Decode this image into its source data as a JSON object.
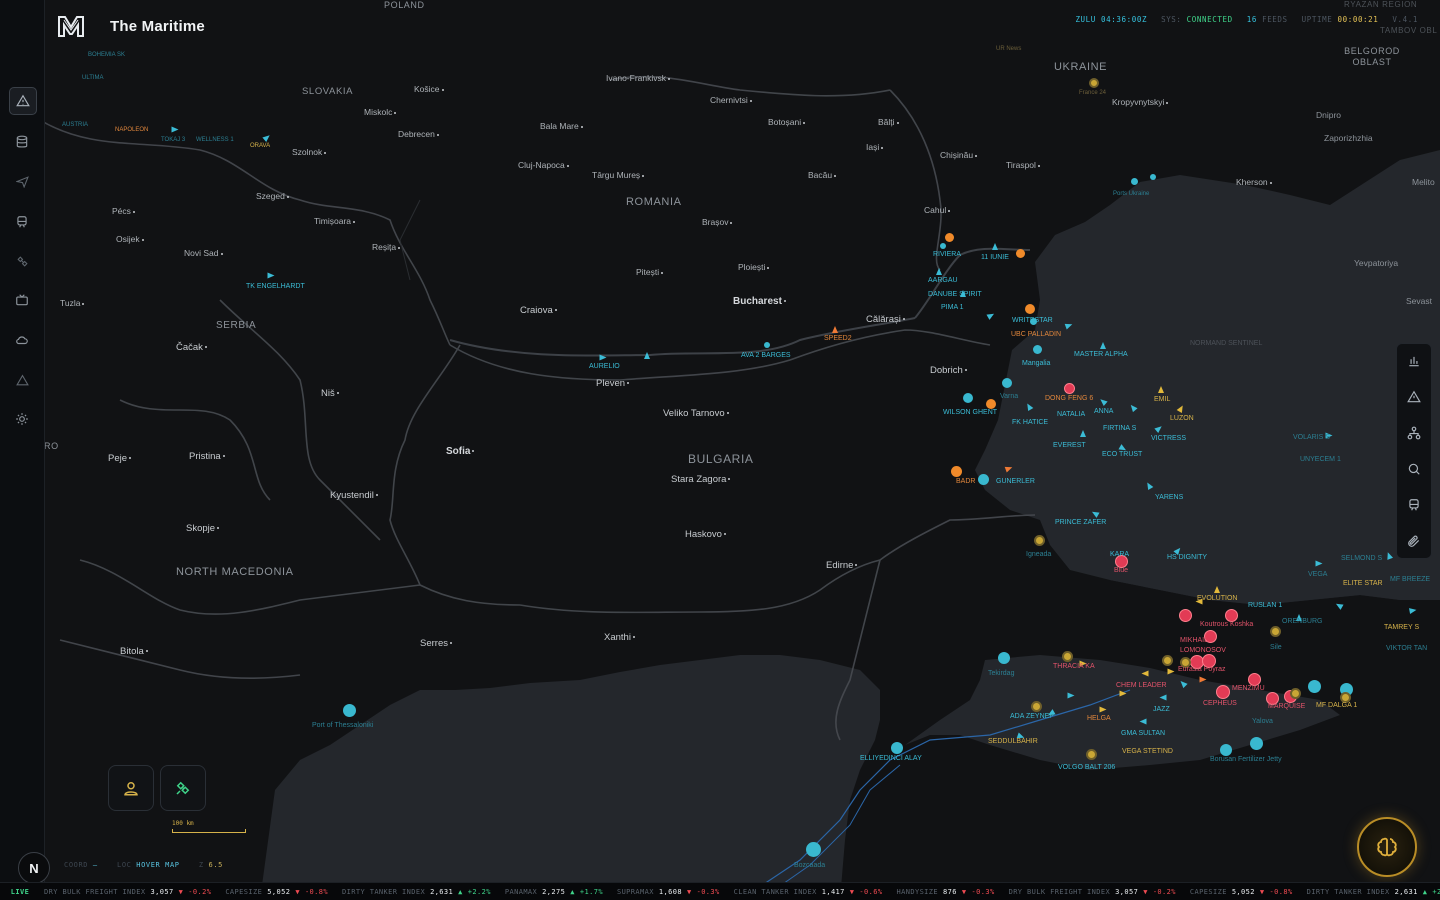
{
  "app": {
    "title": "The Maritime"
  },
  "status": {
    "zulu_label": "ZULU",
    "zulu_time": "04:36:00Z",
    "sys_label": "SYS:",
    "sys_value": "CONNECTED",
    "feeds_count": "16",
    "feeds_label": "FEEDS",
    "uptime_label": "UPTIME",
    "uptime_value": "00:00:21",
    "version": "V.4.1"
  },
  "left_rail": {
    "items": [
      "alert-triangle-icon",
      "database-icon",
      "aircraft-icon",
      "train-icon",
      "satellite-icon",
      "tv-icon",
      "cloud-icon",
      "warning-icon",
      "sun-icon"
    ]
  },
  "right_tools": {
    "items": [
      "bar-chart-icon",
      "alert-icon",
      "network-icon",
      "search-icon",
      "train-icon",
      "paperclip-icon"
    ]
  },
  "countries": [
    "POLAND",
    "UKRAINE",
    "SLOVAKIA",
    "ROMANIA",
    "SERBIA",
    "BULGARIA",
    "NORTH MACEDONIA",
    "BELGOROD OBLAST",
    "RYAZAN REGION",
    "TAMBOV OBL",
    "RO"
  ],
  "cities": [
    "Ivano-Frankivsk",
    "Chernivtsi",
    "Košice",
    "Miskolc",
    "Bala Mare",
    "Debrecen",
    "Botoșani",
    "Bălți",
    "Iași",
    "Chișinău",
    "Tiraspol",
    "Kropyvnytskyi",
    "Dnipro",
    "Zaporizhzhia",
    "Kherson",
    "Melito",
    "Szolnok",
    "Cluj-Napoca",
    "Târgu Mureș",
    "Bacău",
    "Szeged",
    "Pécs",
    "Osijek",
    "Timișoara",
    "Reșița",
    "Cahul",
    "Novi Sad",
    "Yevpatoriya",
    "Pitești",
    "Ploiești",
    "Brașov",
    "Bucharest",
    "Tuzla",
    "Craiova",
    "Călărași",
    "Sevast",
    "Čačak",
    "Pleven",
    "Dobrich",
    "Niš",
    "Veliko Tarnovo",
    "Sofia",
    "Pristina",
    "Peje",
    "Stara Zagora",
    "Kyustendil",
    "Skopje",
    "Haskovo",
    "Edirne",
    "Xanthi",
    "Serres",
    "Bitola"
  ],
  "vessels": [
    "RIVIERA",
    "11 IUNIE",
    "AARGAU",
    "DANUBE SPIRIT",
    "PIMA 1",
    "WRITESTAR",
    "UBC PALLADIN",
    "MASTER ALPHA",
    "NORMAND SENTINEL",
    "Mangalia",
    "DONG FENG 6",
    "EMIL",
    "LUZON",
    "NATALIA",
    "ANNA",
    "WILSON GHENT",
    "Varna",
    "FK HATICE",
    "FIRTINA S",
    "VICTRESS",
    "VOLARIS S",
    "EVEREST",
    "ECO TRUST",
    "UNYECEM 1",
    "BADR",
    "GUNERLER",
    "YARENS",
    "PRINCE ZAFER",
    "Igneada",
    "KARA",
    "Blue",
    "HS DIGNITY",
    "SELMOND S",
    "VEGA",
    "ELITE STAR",
    "MF BREEZE",
    "EVOLUTION",
    "RUSLAN 1",
    "ORENBURG",
    "TAMREY S",
    "Koutrous Koshka",
    "VIKTOR TAN",
    "MIKHAIL LOMONOSOV",
    "Sile",
    "THRACIA KA",
    "Eurasia Poyraz",
    "Tekirdag",
    "CHEM LEADER",
    "MENZIMU",
    "JAZZ",
    "CEPHEUS",
    "MARQUISE",
    "MF DALGA 1",
    "ADA ZEYNEP",
    "HELGA",
    "Yalova",
    "GMA SULTAN",
    "SEDDULBAHIR",
    "VEGA STETIND",
    "ELLIYEDINCI ALAY",
    "Borusan Fertilizer Jetty",
    "VOLGO BALT 206",
    "Port of Thessaloniki",
    "Bozcaada",
    "SPEED2",
    "AURELIO",
    "AVA 2 BARGES",
    "TK ENGELHARDT",
    "TOKAJ 3",
    "WELLNESS 1",
    "ORAVA",
    "NAPOLEON",
    "AUSTRIA",
    "BOHEMIA SK",
    "ULTIMA",
    "UR News",
    "France 24",
    "Ports Ukraine"
  ],
  "scale": {
    "label": "100 km"
  },
  "coord_bar": {
    "coord_label": "COORD",
    "coord_value": "—",
    "loc_label": "LOC",
    "loc_value": "HOVER MAP",
    "z_label": "Z",
    "z_value": "6.5"
  },
  "n_button": "N",
  "live_label": "LIVE",
  "ticker": [
    {
      "name": "DRY BULK FREIGHT INDEX",
      "value": "3,057",
      "dir": "down",
      "change": "-0.2%"
    },
    {
      "name": "CAPESIZE",
      "value": "5,052",
      "dir": "down",
      "change": "-0.8%"
    },
    {
      "name": "DIRTY TANKER INDEX",
      "value": "2,631",
      "dir": "up",
      "change": "+2.2%"
    },
    {
      "name": "PANAMAX",
      "value": "2,275",
      "dir": "up",
      "change": "+1.7%"
    },
    {
      "name": "SUPRAMAX",
      "value": "1,608",
      "dir": "down",
      "change": "-0.3%"
    },
    {
      "name": "CLEAN TANKER INDEX",
      "value": "1,417",
      "dir": "down",
      "change": "-0.6%"
    },
    {
      "name": "HANDYSIZE",
      "value": "876",
      "dir": "down",
      "change": "-0.3%"
    },
    {
      "name": "DRY BULK FREIGHT INDEX",
      "value": "3,057",
      "dir": "down",
      "change": "-0.2%"
    },
    {
      "name": "CAPESIZE",
      "value": "5,052",
      "dir": "down",
      "change": "-0.8%"
    },
    {
      "name": "DIRTY TANKER INDEX",
      "value": "2,631",
      "dir": "up",
      "change": "+2.2%"
    }
  ],
  "colors": {
    "accent_cyan": "#36c3e0",
    "accent_gold": "#c9a635",
    "alert_red": "#e23b55",
    "orange": "#f08a2a",
    "sea": "#23262b",
    "land": "#121315"
  }
}
